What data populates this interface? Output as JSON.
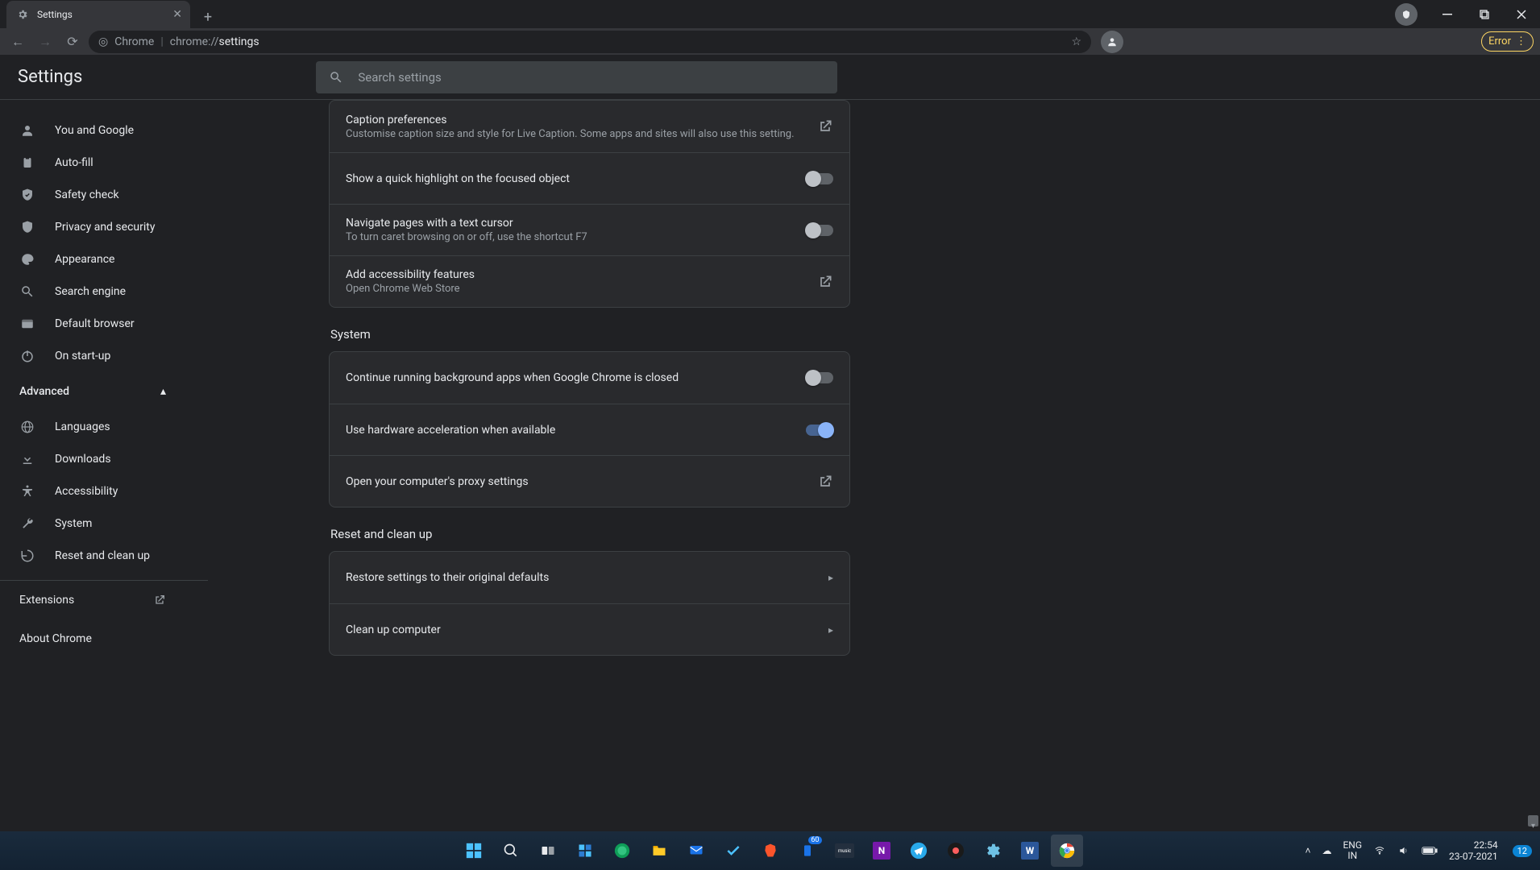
{
  "browser": {
    "tab_title": "Settings",
    "url_scheme_label": "Chrome",
    "url_prefix": "chrome://",
    "url_path": "settings",
    "error_label": "Error"
  },
  "header": {
    "title": "Settings",
    "search_placeholder": "Search settings"
  },
  "sidebar": {
    "main": [
      {
        "icon": "person",
        "label": "You and Google"
      },
      {
        "icon": "clipboard",
        "label": "Auto-fill"
      },
      {
        "icon": "shield-check",
        "label": "Safety check"
      },
      {
        "icon": "shield",
        "label": "Privacy and security"
      },
      {
        "icon": "palette",
        "label": "Appearance"
      },
      {
        "icon": "search",
        "label": "Search engine"
      },
      {
        "icon": "window",
        "label": "Default browser"
      },
      {
        "icon": "power",
        "label": "On start-up"
      }
    ],
    "advanced_label": "Advanced",
    "advanced": [
      {
        "icon": "globe",
        "label": "Languages"
      },
      {
        "icon": "download",
        "label": "Downloads"
      },
      {
        "icon": "accessibility",
        "label": "Accessibility"
      },
      {
        "icon": "wrench",
        "label": "System"
      },
      {
        "icon": "restore",
        "label": "Reset and clean up"
      }
    ],
    "extensions_label": "Extensions",
    "about_label": "About Chrome"
  },
  "sections": {
    "accessibility_rows": {
      "caption_title": "Caption preferences",
      "caption_sub": "Customise caption size and style for Live Caption. Some apps and sites will also use this setting.",
      "highlight_title": "Show a quick highlight on the focused object",
      "highlight_on": false,
      "caret_title": "Navigate pages with a text cursor",
      "caret_sub": "To turn caret browsing on or off, use the shortcut F7",
      "caret_on": false,
      "add_title": "Add accessibility features",
      "add_sub": "Open Chrome Web Store"
    },
    "system_title": "System",
    "system_rows": {
      "bg_title": "Continue running background apps when Google Chrome is closed",
      "bg_on": false,
      "hw_title": "Use hardware acceleration when available",
      "hw_on": true,
      "proxy_title": "Open your computer's proxy settings"
    },
    "reset_title": "Reset and clean up",
    "reset_rows": {
      "restore_title": "Restore settings to their original defaults",
      "clean_title": "Clean up computer"
    }
  },
  "taskbar": {
    "lang_top": "ENG",
    "lang_bottom": "IN",
    "time": "22:54",
    "date": "23-07-2021",
    "notif_count": "12",
    "mail_badge": "60"
  }
}
